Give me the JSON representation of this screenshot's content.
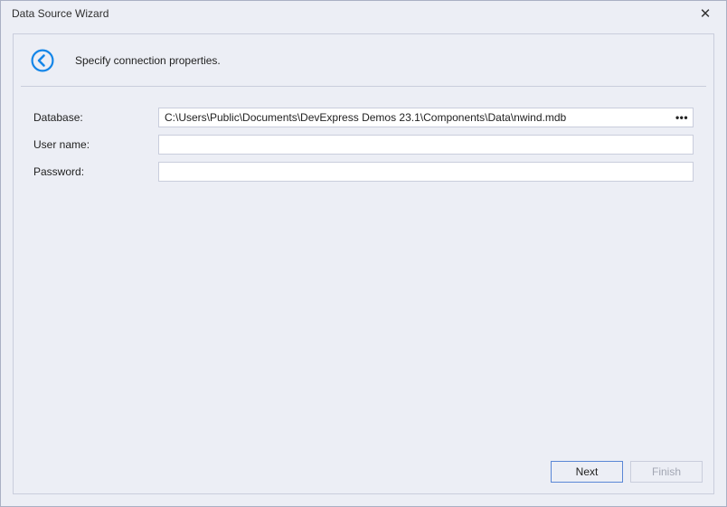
{
  "window": {
    "title": "Data Source Wizard",
    "close_symbol": "✕"
  },
  "header": {
    "instruction": "Specify connection properties."
  },
  "form": {
    "database": {
      "label": "Database:",
      "value": "C:\\Users\\Public\\Documents\\DevExpress Demos 23.1\\Components\\Data\\nwind.mdb",
      "browse_symbol": "•••"
    },
    "username": {
      "label": "User name:",
      "value": ""
    },
    "password": {
      "label": "Password:",
      "value": ""
    }
  },
  "footer": {
    "next_label": "Next",
    "finish_label": "Finish"
  }
}
